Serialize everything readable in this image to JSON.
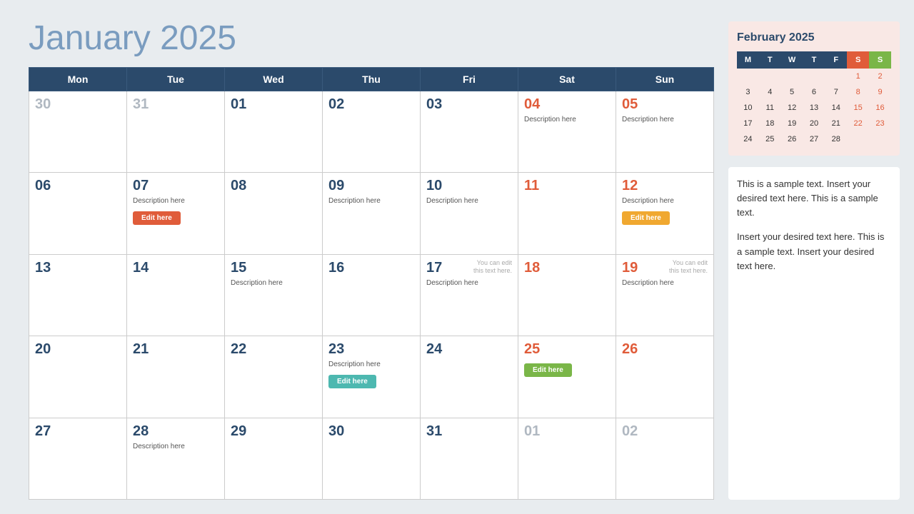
{
  "header": {
    "title_bold": "January",
    "title_light": "2025"
  },
  "calendar": {
    "headers": [
      "Mon",
      "Tue",
      "Wed",
      "Thu",
      "Fri",
      "Sat",
      "Sun"
    ],
    "rows": [
      [
        {
          "num": "30",
          "inactive": true
        },
        {
          "num": "31",
          "inactive": true
        },
        {
          "num": "01"
        },
        {
          "num": "02"
        },
        {
          "num": "03"
        },
        {
          "num": "04",
          "weekend": true,
          "desc": "Description here"
        },
        {
          "num": "05",
          "weekend": true,
          "desc": "Description here"
        }
      ],
      [
        {
          "num": "06"
        },
        {
          "num": "07",
          "desc": "Description here",
          "btn": "Edit here",
          "btn_class": "btn-red"
        },
        {
          "num": "08"
        },
        {
          "num": "09",
          "desc": "Description here"
        },
        {
          "num": "10",
          "desc": "Description here"
        },
        {
          "num": "11",
          "weekend": true
        },
        {
          "num": "12",
          "weekend": true,
          "desc": "Description here",
          "btn": "Edit here",
          "btn_class": "btn-orange"
        }
      ],
      [
        {
          "num": "13"
        },
        {
          "num": "14"
        },
        {
          "num": "15",
          "desc": "Description here"
        },
        {
          "num": "16"
        },
        {
          "num": "17",
          "desc": "Description here",
          "note": "You can edit this text here."
        },
        {
          "num": "18",
          "weekend": true
        },
        {
          "num": "19",
          "weekend": true,
          "desc": "Description here",
          "note": "You can edit this text here."
        }
      ],
      [
        {
          "num": "20"
        },
        {
          "num": "21"
        },
        {
          "num": "22"
        },
        {
          "num": "23",
          "desc": "Description here",
          "btn": "Edit here",
          "btn_class": "btn-teal"
        },
        {
          "num": "24"
        },
        {
          "num": "25",
          "weekend": true,
          "btn": "Edit here",
          "btn_class": "btn-green"
        },
        {
          "num": "26",
          "weekend": true
        }
      ],
      [
        {
          "num": "27"
        },
        {
          "num": "28",
          "desc": "Description here"
        },
        {
          "num": "29"
        },
        {
          "num": "30"
        },
        {
          "num": "31"
        },
        {
          "num": "01",
          "inactive": true
        },
        {
          "num": "02",
          "inactive": true
        }
      ]
    ]
  },
  "sidebar": {
    "mini_cal_title": "February 2025",
    "mini_cal_headers": [
      "M",
      "T",
      "W",
      "T",
      "F",
      "S",
      "S"
    ],
    "mini_cal_header_colors": [
      "blue",
      "blue",
      "blue",
      "blue",
      "blue",
      "orange",
      "green"
    ],
    "mini_cal_rows": [
      [
        "",
        "",
        "",
        "",
        "",
        "1",
        "2"
      ],
      [
        "3",
        "4",
        "5",
        "6",
        "7",
        "8",
        "9"
      ],
      [
        "10",
        "11",
        "12",
        "13",
        "14",
        "15",
        "16"
      ],
      [
        "17",
        "18",
        "19",
        "20",
        "21",
        "22",
        "23"
      ],
      [
        "24",
        "25",
        "26",
        "27",
        "28",
        "",
        ""
      ]
    ],
    "text1": "This is a sample text. Insert your desired text here. This is a sample text.",
    "text2": "Insert your desired text here. This is a sample text. Insert your desired text here."
  }
}
